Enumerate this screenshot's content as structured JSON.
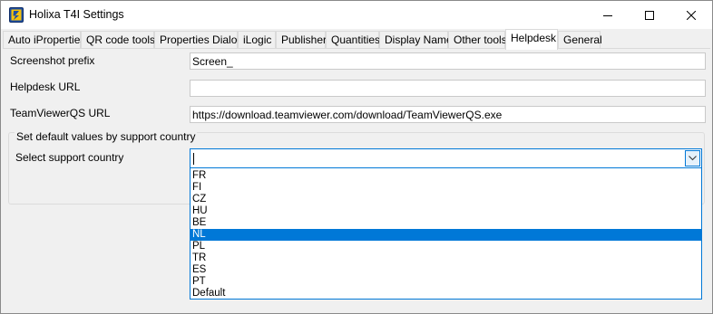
{
  "window": {
    "title": "Holixa T4I Settings",
    "accent_color": "#0078d7",
    "icon": "holixa-app-icon",
    "controls": [
      "minimize-icon",
      "maximize-icon",
      "close-icon"
    ]
  },
  "tabs": [
    {
      "label": "Auto iProperties",
      "active": false
    },
    {
      "label": "QR code tools",
      "active": false
    },
    {
      "label": "Properties Dialog",
      "active": false
    },
    {
      "label": "iLogic",
      "active": false
    },
    {
      "label": "Publisher",
      "active": false
    },
    {
      "label": "Quantities",
      "active": false
    },
    {
      "label": "Display Name",
      "active": false
    },
    {
      "label": "Other tools",
      "active": false
    },
    {
      "label": "Helpdesk",
      "active": true
    },
    {
      "label": "General",
      "active": false
    }
  ],
  "helpdesk": {
    "screenshot_prefix": {
      "label": "Screenshot prefix",
      "value": "Screen_"
    },
    "helpdesk_url": {
      "label": "Helpdesk URL",
      "value": ""
    },
    "teamviewer_url": {
      "label": "TeamViewerQS URL",
      "value": "https://download.teamviewer.com/download/TeamViewerQS.exe"
    },
    "defaults_group": {
      "title": "Set default values by support country",
      "country_label": "Select support country",
      "country_value": "",
      "options": [
        "FR",
        "FI",
        "CZ",
        "HU",
        "BE",
        "NL",
        "PL",
        "TR",
        "ES",
        "PT",
        "Default"
      ],
      "highlighted": "NL"
    }
  }
}
